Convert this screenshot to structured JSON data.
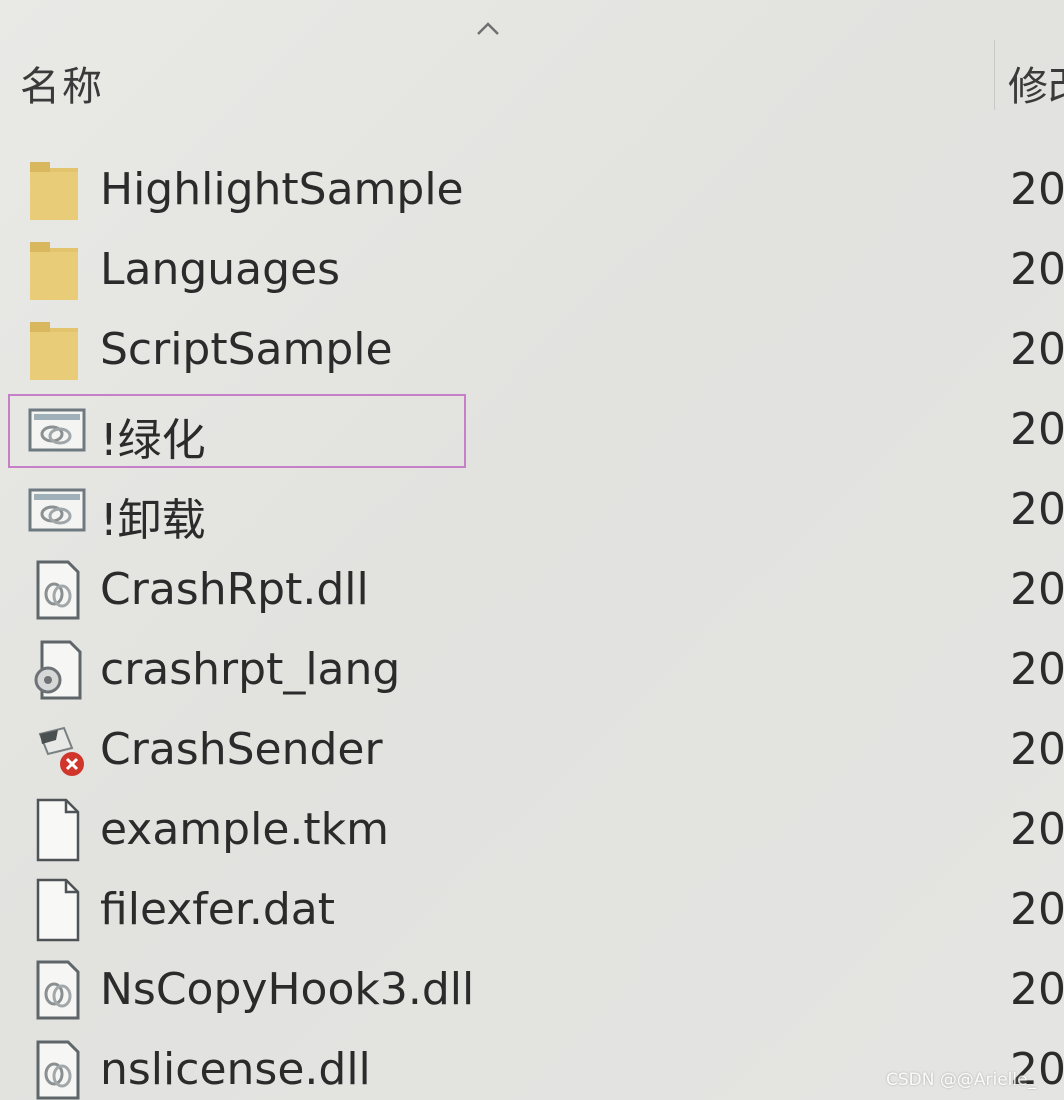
{
  "header": {
    "name_column": "名称",
    "date_column": "修改"
  },
  "files": [
    {
      "name": "HighlightSample",
      "date": "20",
      "icon": "folder-icon",
      "type": "folder"
    },
    {
      "name": "Languages",
      "date": "20",
      "icon": "folder-icon",
      "type": "folder"
    },
    {
      "name": "ScriptSample",
      "date": "20",
      "icon": "folder-icon",
      "type": "folder"
    },
    {
      "name": "!绿化",
      "date": "20",
      "icon": "batch-file-icon",
      "type": "batch",
      "selected_outline": true
    },
    {
      "name": "!卸载",
      "date": "20",
      "icon": "batch-file-icon",
      "type": "batch"
    },
    {
      "name": "CrashRpt.dll",
      "date": "20",
      "icon": "dll-file-icon",
      "type": "dll"
    },
    {
      "name": "crashrpt_lang",
      "date": "20",
      "icon": "settings-file-icon",
      "type": "ini"
    },
    {
      "name": "CrashSender",
      "date": "20",
      "icon": "crash-sender-icon",
      "type": "exe"
    },
    {
      "name": "example.tkm",
      "date": "20",
      "icon": "blank-file-icon",
      "type": "file"
    },
    {
      "name": "filexfer.dat",
      "date": "20",
      "icon": "blank-file-icon",
      "type": "file"
    },
    {
      "name": "NsCopyHook3.dll",
      "date": "20",
      "icon": "dll-file-icon",
      "type": "dll"
    },
    {
      "name": "nslicense.dll",
      "date": "20",
      "icon": "dll-file-icon",
      "type": "dll"
    }
  ],
  "watermark": "CSDN @@Arielle_",
  "colors": {
    "folder": "#e3c46e",
    "highlight_outline": "#c77fc7",
    "crash_badge": "#d0362b"
  }
}
